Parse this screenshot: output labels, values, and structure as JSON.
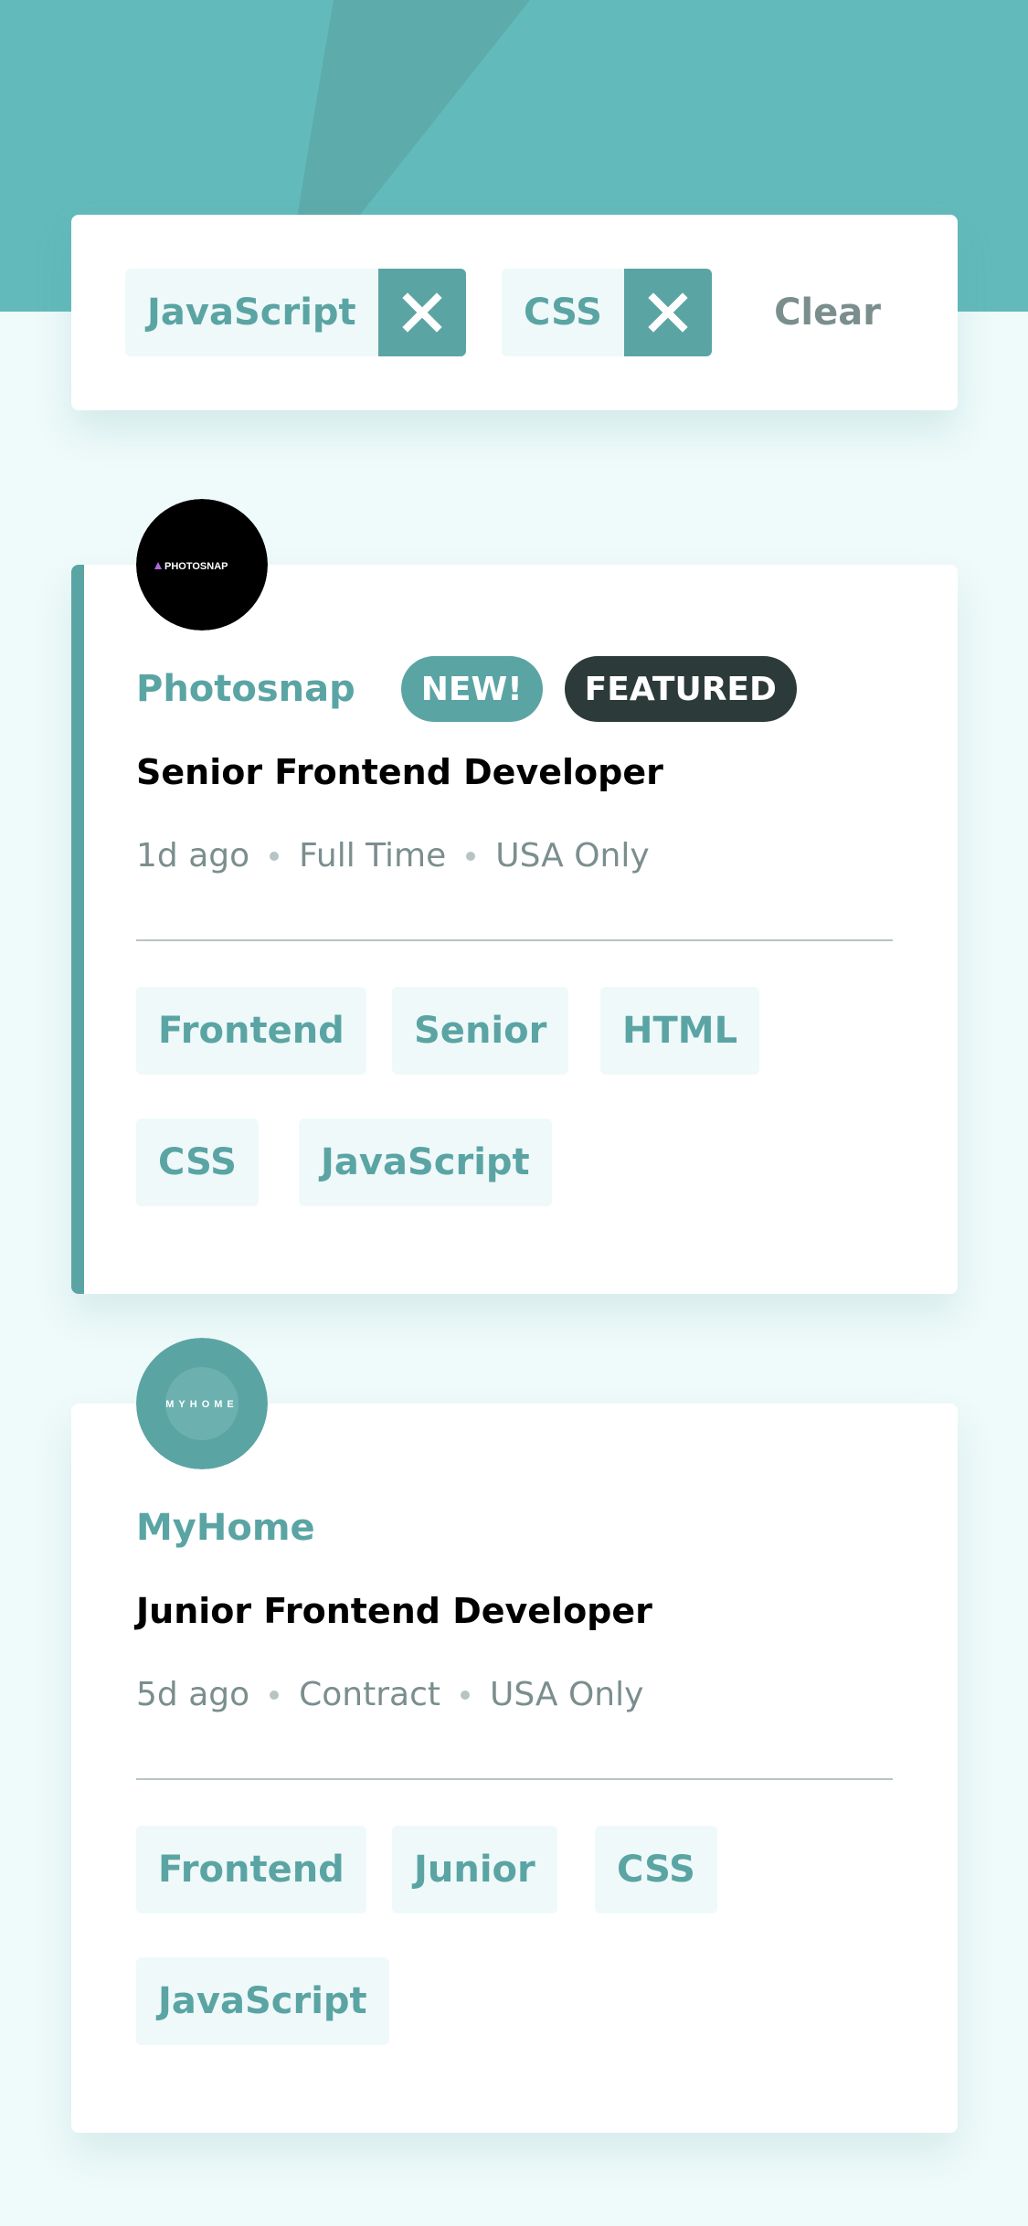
{
  "filters": {
    "active": [
      {
        "label": "JavaScript"
      },
      {
        "label": "CSS"
      }
    ],
    "clear_label": "Clear"
  },
  "jobs": [
    {
      "company": "Photosnap",
      "logo_text": "PHOTOSNAP",
      "badges": {
        "new": "NEW!",
        "featured": "FEATURED"
      },
      "position": "Senior Frontend Developer",
      "posted": "1d ago",
      "contract": "Full Time",
      "location": "USA Only",
      "tags": [
        "Frontend",
        "Senior",
        "HTML",
        "CSS",
        "JavaScript"
      ]
    },
    {
      "company": "MyHome",
      "logo_text": "MYHOME",
      "position": "Junior Frontend Developer",
      "posted": "5d ago",
      "contract": "Contract",
      "location": "USA Only",
      "tags": [
        "Frontend",
        "Junior",
        "CSS",
        "JavaScript"
      ]
    }
  ],
  "colors": {
    "primary": "#5ba4a4",
    "header_bg": "#63baba",
    "page_bg": "#effafa",
    "tag_bg": "#eff9f9",
    "dark": "#2c3a3a",
    "gray": "#7b8e8e"
  }
}
